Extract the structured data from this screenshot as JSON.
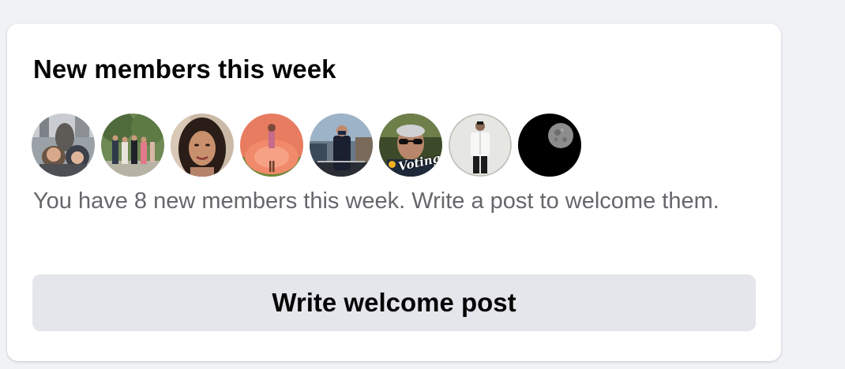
{
  "card": {
    "title": "New members this week",
    "description": "You have 8 new members this week. Write a post to welcome them.",
    "button_label": "Write welcome post"
  },
  "members": [
    {
      "name": "member-1",
      "badge": ""
    },
    {
      "name": "member-2",
      "badge": ""
    },
    {
      "name": "member-3",
      "badge": ""
    },
    {
      "name": "member-4",
      "badge": ""
    },
    {
      "name": "member-5",
      "badge": ""
    },
    {
      "name": "member-6",
      "badge": "Voting"
    },
    {
      "name": "member-7",
      "badge": ""
    },
    {
      "name": "member-8",
      "badge": ""
    }
  ],
  "colors": {
    "page_bg": "#f0f2f5",
    "card_bg": "#ffffff",
    "title": "#050505",
    "secondary_text": "#65676b",
    "button_bg": "#e4e6eb"
  }
}
